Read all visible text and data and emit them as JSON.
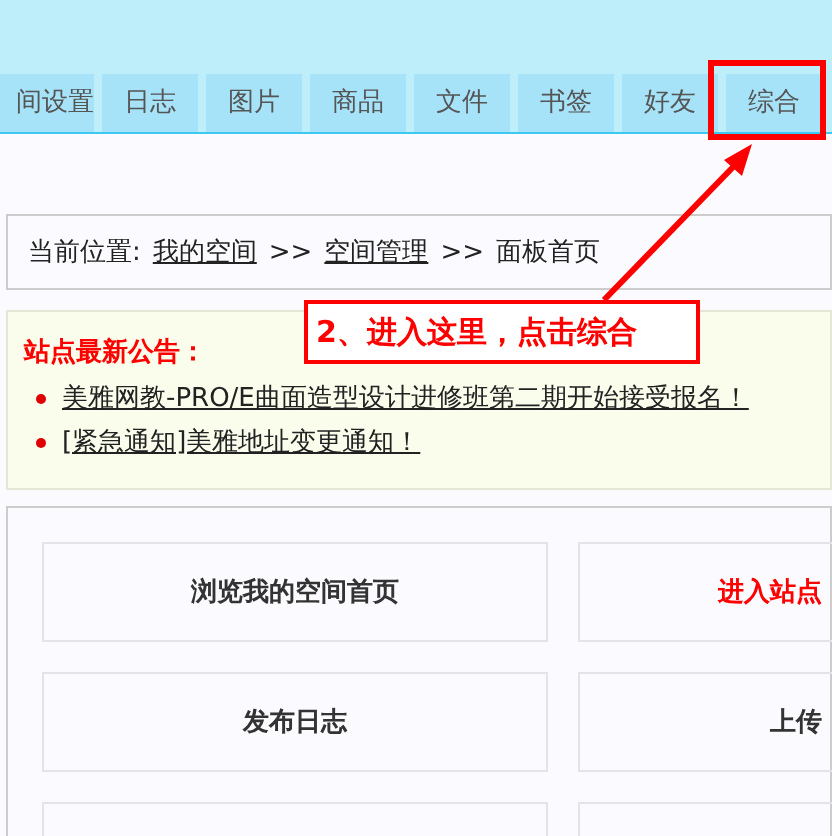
{
  "tabs": [
    {
      "label": "间设置",
      "highlighted": false
    },
    {
      "label": "日志",
      "highlighted": false
    },
    {
      "label": "图片",
      "highlighted": false
    },
    {
      "label": "商品",
      "highlighted": false
    },
    {
      "label": "文件",
      "highlighted": false
    },
    {
      "label": "书签",
      "highlighted": false
    },
    {
      "label": "好友",
      "highlighted": false
    },
    {
      "label": "综合",
      "highlighted": true
    }
  ],
  "breadcrumb": {
    "prefix": "当前位置:",
    "links": [
      "我的空间",
      "空间管理"
    ],
    "separator": ">>",
    "current": "面板首页"
  },
  "announcements": {
    "title": "站点最新公告：",
    "items": [
      "美雅网教-PRO/E曲面造型设计进修班第二期开始接受报名！",
      "[紧急通知]美雅地址变更通知！"
    ]
  },
  "panel": {
    "cells": [
      {
        "label": "浏览我的空间首页",
        "emphasis": false
      },
      {
        "label": "进入站点",
        "emphasis": true
      },
      {
        "label": "发布日志",
        "emphasis": false
      },
      {
        "label": "上传",
        "emphasis": false
      },
      {},
      {}
    ]
  },
  "annotation": {
    "label": "2、进入这里，点击综合"
  }
}
